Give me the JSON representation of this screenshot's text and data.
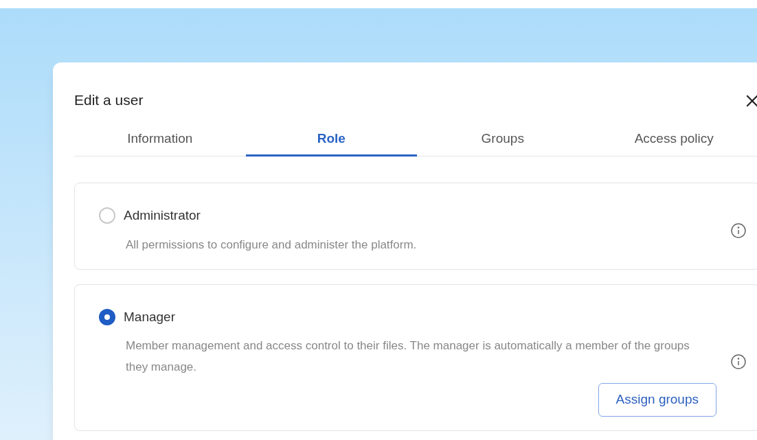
{
  "dialog": {
    "title": "Edit a user"
  },
  "tabs": [
    {
      "label": "Information",
      "selected": false
    },
    {
      "label": "Role",
      "selected": true
    },
    {
      "label": "Groups",
      "selected": false
    },
    {
      "label": "Access policy",
      "selected": false
    }
  ],
  "roles": [
    {
      "name": "Administrator",
      "description": "All permissions to configure and administer the platform.",
      "selected": false
    },
    {
      "name": "Manager",
      "description": "Member management and access control to their files. The manager is automatically a member of the groups they manage.",
      "selected": true,
      "action": "Assign groups"
    }
  ]
}
